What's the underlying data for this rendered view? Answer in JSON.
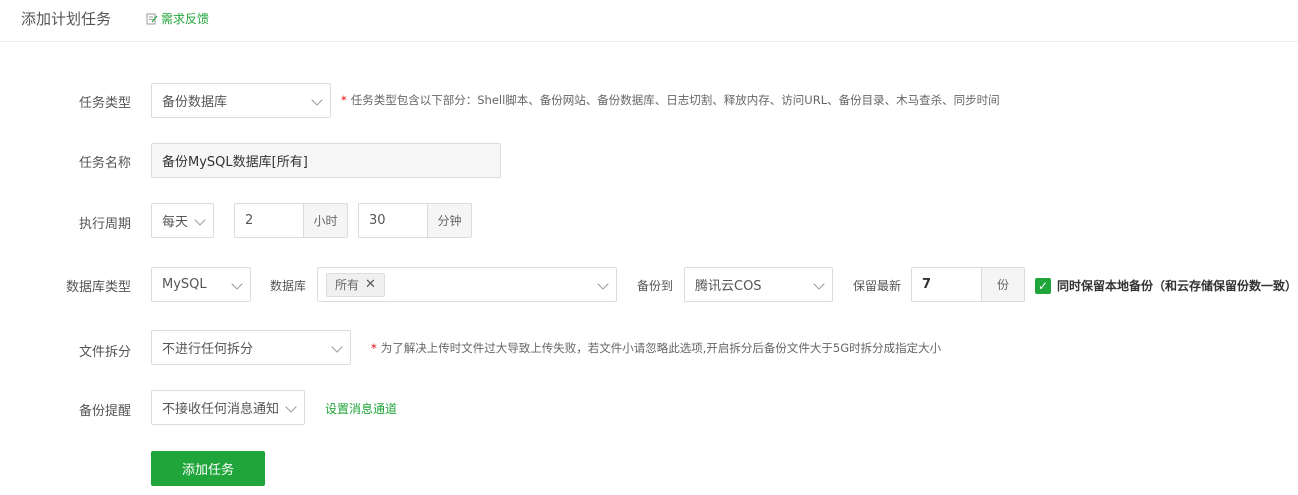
{
  "header": {
    "title": "添加计划任务",
    "feedback_label": "需求反馈"
  },
  "task_type": {
    "label": "任务类型",
    "value": "备份数据库",
    "hint": "任务类型包含以下部分：Shell脚本、备份网站、备份数据库、日志切割、释放内存、访问URL、备份目录、木马查杀、同步时间"
  },
  "task_name": {
    "label": "任务名称",
    "value": "备份MySQL数据库[所有]"
  },
  "period": {
    "label": "执行周期",
    "cycle": "每天",
    "hour": "2",
    "hour_unit": "小时",
    "minute": "30",
    "minute_unit": "分钟"
  },
  "database": {
    "label": "数据库类型",
    "type": "MySQL",
    "db_label": "数据库",
    "db_tag": "所有",
    "backup_to_label": "备份到",
    "backup_to": "腾讯云COS",
    "keep_label": "保留最新",
    "keep_value": "7",
    "keep_unit": "份",
    "keep_local_label": "同时保留本地备份（和云存储保留份数一致）",
    "keep_local_checked": true
  },
  "split": {
    "label": "文件拆分",
    "value": "不进行任何拆分",
    "hint": "为了解决上传时文件过大导致上传失败，若文件小请忽略此选项,开启拆分后备份文件大于5G时拆分成指定大小"
  },
  "notify": {
    "label": "备份提醒",
    "value": "不接收任何消息通知",
    "link": "设置消息通道"
  },
  "submit_label": "添加任务",
  "colors": {
    "accent": "#20a53a",
    "required_star": "#ef0808"
  }
}
